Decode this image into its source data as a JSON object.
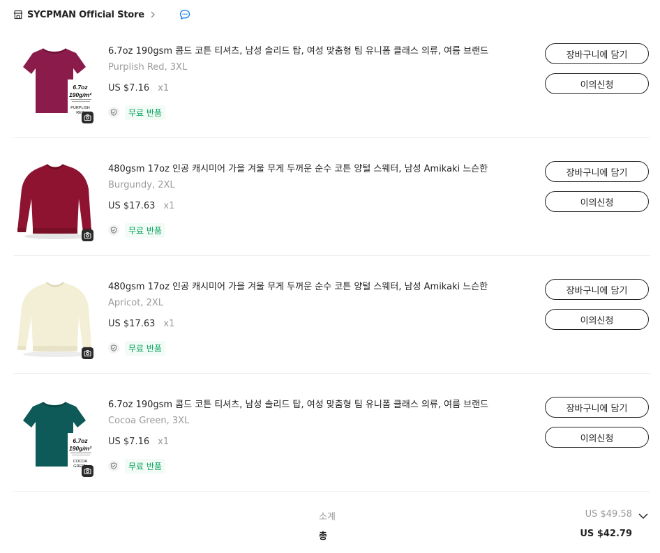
{
  "store": {
    "name": "SYCPMAN Official Store",
    "store_icon": "store-icon",
    "chevron_icon": "chevron-right-icon",
    "chat_icon": "chat-bubble-icon"
  },
  "items": [
    {
      "title": "6.7oz 190gsm 콤드 코튼 티셔츠, 남성 솔리드 탑, 여성 맞춤형 팀 유니폼 클래스 의류, 여름 브랜드",
      "variant": "Purplish Red, 3XL",
      "price": "US $7.16",
      "qty": "x1",
      "return_label": "무료 반품",
      "add_to_cart_label": "장바구니에 담기",
      "dispute_label": "이의신청",
      "image": {
        "garment": "tshirt",
        "color": "#8a1b4a",
        "weight_text": "6.7oz",
        "gsm_text": "190g/m²",
        "color_text_1": "PURPLISH",
        "color_text_2": "RED"
      }
    },
    {
      "title": "480gsm 17oz 인공 캐시미어 가을 겨울 무게 두꺼운 순수 코튼 양털 스웨터, 남성 Amikaki 느슨한",
      "variant": "Burgundy, 2XL",
      "price": "US $17.63",
      "qty": "x1",
      "return_label": "무료 반품",
      "add_to_cart_label": "장바구니에 담기",
      "dispute_label": "이의신청",
      "image": {
        "garment": "sweatshirt",
        "color": "#8e1330"
      }
    },
    {
      "title": "480gsm 17oz 인공 캐시미어 가을 겨울 무게 두꺼운 순수 코튼 양털 스웨터, 남성 Amikaki 느슨한",
      "variant": "Apricot, 2XL",
      "price": "US $17.63",
      "qty": "x1",
      "return_label": "무료 반품",
      "add_to_cart_label": "장바구니에 담기",
      "dispute_label": "이의신청",
      "image": {
        "garment": "sweatshirt",
        "color": "#f3efd6"
      }
    },
    {
      "title": "6.7oz 190gsm 콤드 코튼 티셔츠, 남성 솔리드 탑, 여성 맞춤형 팀 유니폼 클래스 의류, 여름 브랜드",
      "variant": "Cocoa Green, 3XL",
      "price": "US $7.16",
      "qty": "x1",
      "return_label": "무료 반품",
      "add_to_cart_label": "장바구니에 담기",
      "dispute_label": "이의신청",
      "image": {
        "garment": "tshirt",
        "color": "#0e5a58",
        "weight_text": "6.7oz",
        "gsm_text": "190g/m²",
        "color_text_1": "COCOA",
        "color_text_2": "GREEN"
      }
    }
  ],
  "summary": {
    "subtotal_label": "소계",
    "subtotal_value": "US $49.58",
    "total_label": "총",
    "total_value": "US $42.79",
    "expand_icon": "chevron-down-icon"
  },
  "colors": {
    "return_green": "#00a05a",
    "chat_blue": "#1e7ff0",
    "muted_text": "#9a9a9a"
  }
}
